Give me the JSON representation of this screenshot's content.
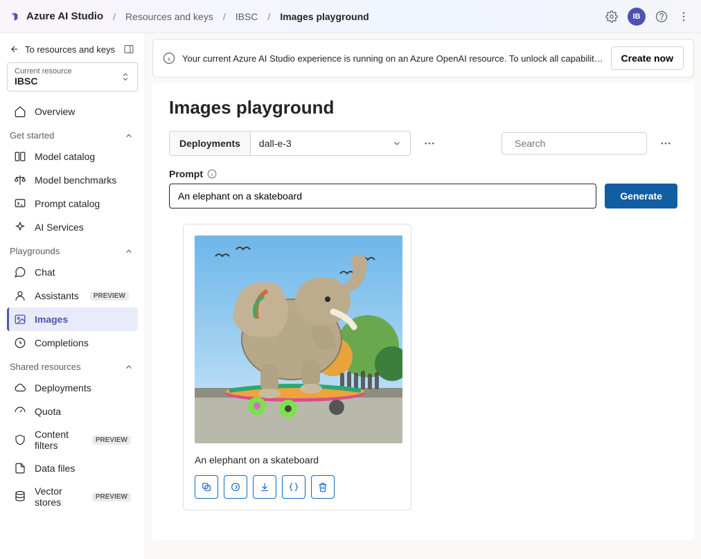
{
  "header": {
    "brand": "Azure AI Studio",
    "breadcrumbs": [
      "Resources and keys",
      "IBSC",
      "Images playground"
    ],
    "avatar_initials": "IB"
  },
  "sidebar": {
    "back_label": "To resources and keys",
    "resource_label": "Current resource",
    "resource_value": "IBSC",
    "overview": "Overview",
    "section_get_started": "Get started",
    "get_started": [
      {
        "label": "Model catalog"
      },
      {
        "label": "Model benchmarks"
      },
      {
        "label": "Prompt catalog"
      },
      {
        "label": "AI Services"
      }
    ],
    "section_playgrounds": "Playgrounds",
    "playgrounds": [
      {
        "label": "Chat"
      },
      {
        "label": "Assistants",
        "preview": "PREVIEW"
      },
      {
        "label": "Images"
      },
      {
        "label": "Completions"
      }
    ],
    "section_shared": "Shared resources",
    "shared": [
      {
        "label": "Deployments"
      },
      {
        "label": "Quota"
      },
      {
        "label": "Content filters",
        "preview": "PREVIEW"
      },
      {
        "label": "Data files"
      },
      {
        "label": "Vector stores",
        "preview": "PREVIEW"
      }
    ]
  },
  "banner": {
    "text": "Your current Azure AI Studio experience is running on an Azure OpenAI resource. To unlock all capabilities, create a...",
    "button": "Create now"
  },
  "page": {
    "title": "Images playground",
    "deployments_label": "Deployments",
    "deployment_selected": "dall-e-3",
    "search_placeholder": "Search",
    "prompt_label": "Prompt",
    "prompt_value": "An elephant on a skateboard",
    "generate_label": "Generate"
  },
  "result": {
    "caption": "An elephant on a skateboard"
  }
}
